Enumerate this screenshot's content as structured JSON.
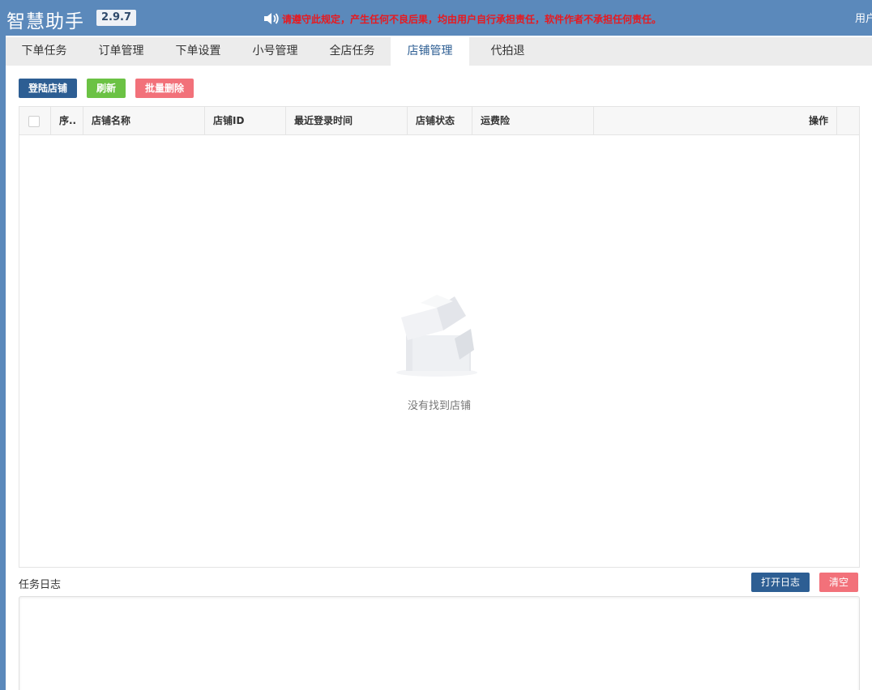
{
  "header": {
    "title": "智慧助手",
    "version": "2.9.7",
    "notice": "请遵守此规定，产生任何不良后果，均由用户自行承担责任，软件作者不承担任何责任。",
    "user_label": "用户"
  },
  "tabs": [
    {
      "label": "下单任务"
    },
    {
      "label": "订单管理"
    },
    {
      "label": "下单设置"
    },
    {
      "label": "小号管理"
    },
    {
      "label": "全店任务"
    },
    {
      "label": "店铺管理",
      "active": true
    },
    {
      "label": "代拍退"
    }
  ],
  "toolbar": {
    "login_label": "登陆店铺",
    "refresh_label": "刷新",
    "batch_delete_label": "批量删除"
  },
  "table": {
    "columns": [
      "序..",
      "店铺名称",
      "店铺ID",
      "最近登录时间",
      "店铺状态",
      "运费险",
      "操作"
    ],
    "rows": [],
    "empty_text": "没有找到店铺"
  },
  "log": {
    "label": "任务日志",
    "open_label": "打开日志",
    "clear_label": "清空"
  },
  "colors": {
    "header_bg": "#5b89bb",
    "primary": "#2d5e93",
    "success": "#6bc244",
    "danger": "#f2717a",
    "notice": "#e8191f"
  }
}
